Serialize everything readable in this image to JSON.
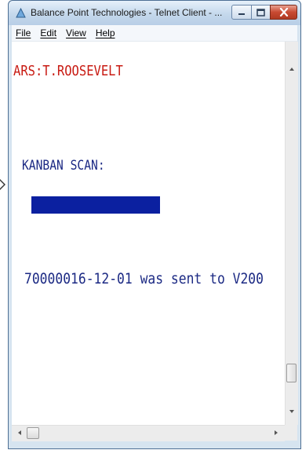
{
  "window": {
    "title": "Balance Point Technologies - Telnet Client - ...",
    "controls": [
      "minimize-icon",
      "maximize-icon",
      "close-icon"
    ],
    "close_color": "#c84a32"
  },
  "menubar": {
    "items": [
      {
        "label": "File"
      },
      {
        "label": "Edit"
      },
      {
        "label": "View"
      },
      {
        "label": "Help"
      }
    ]
  },
  "terminal": {
    "user_line": "ARS:T.ROOSEVELT",
    "scan_label": "KANBAN SCAN:",
    "input_value": "",
    "status_message": "70000016-12-01 was sent to V200",
    "colors": {
      "user_text": "#c81a12",
      "body_text": "#1c2a84",
      "input_highlight": "#0b20a0"
    }
  }
}
